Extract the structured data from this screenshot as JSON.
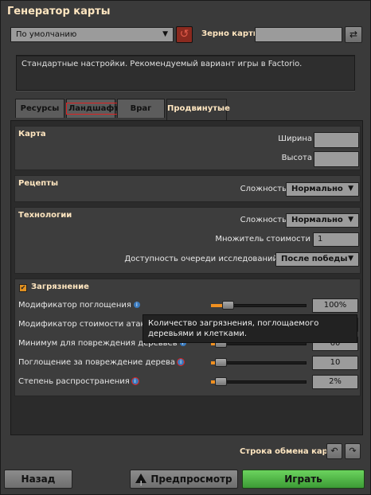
{
  "window": {
    "title": "Генератор карты"
  },
  "preset": {
    "value": "По умолчанию"
  },
  "seed": {
    "label": "Зерно карты",
    "value": ""
  },
  "description": "Стандартные настройки. Рекомендуемый вариант игры в Factorio.",
  "tabs": [
    {
      "label": "Ресурсы",
      "active": false
    },
    {
      "label": "Ландшафт",
      "active": false
    },
    {
      "label": "Враг",
      "active": false
    },
    {
      "label": "Продвинутые",
      "active": true
    }
  ],
  "map": {
    "title": "Карта",
    "width_label": "Ширина",
    "height_label": "Высота",
    "width_value": "",
    "height_value": ""
  },
  "recipes": {
    "title": "Рецепты",
    "difficulty_label": "Сложность",
    "difficulty_value": "Нормально"
  },
  "technology": {
    "title": "Технологии",
    "difficulty_label": "Сложность",
    "difficulty_value": "Нормально",
    "cost_label": "Множитель стоимости",
    "cost_value": "1",
    "queue_label": "Доступность очереди исследований",
    "queue_value": "После победы"
  },
  "pollution": {
    "title": "Загрязнение",
    "enabled": true,
    "rows": [
      {
        "label": "Модификатор поглощения",
        "value": "100%",
        "level": 0.12
      },
      {
        "label": "Модификатор стоимости атаки",
        "value": "",
        "level": 0.12
      },
      {
        "label": "Минимум для повреждения деревьев",
        "value": "60",
        "level": 0.04
      },
      {
        "label": "Поглощение за повреждение дерева",
        "value": "10",
        "level": 0.04
      },
      {
        "label": "Степень распространения",
        "value": "2%",
        "level": 0.04
      }
    ]
  },
  "tooltip": "Количество загрязнения, поглощаемого деревьями и клетками.",
  "footer": {
    "exchange_label": "Строка обмена карты",
    "back": "Назад",
    "preview": "Предпросмотр",
    "play": "Играть"
  },
  "colors": {
    "accent": "#f09020",
    "play": "#4fb845",
    "header": "#ffe6c0"
  },
  "icons": [
    "chevron-down-icon",
    "reset-icon",
    "shuffle-icon",
    "info-icon",
    "checkbox-icon",
    "warning-icon",
    "import-icon",
    "export-icon"
  ]
}
